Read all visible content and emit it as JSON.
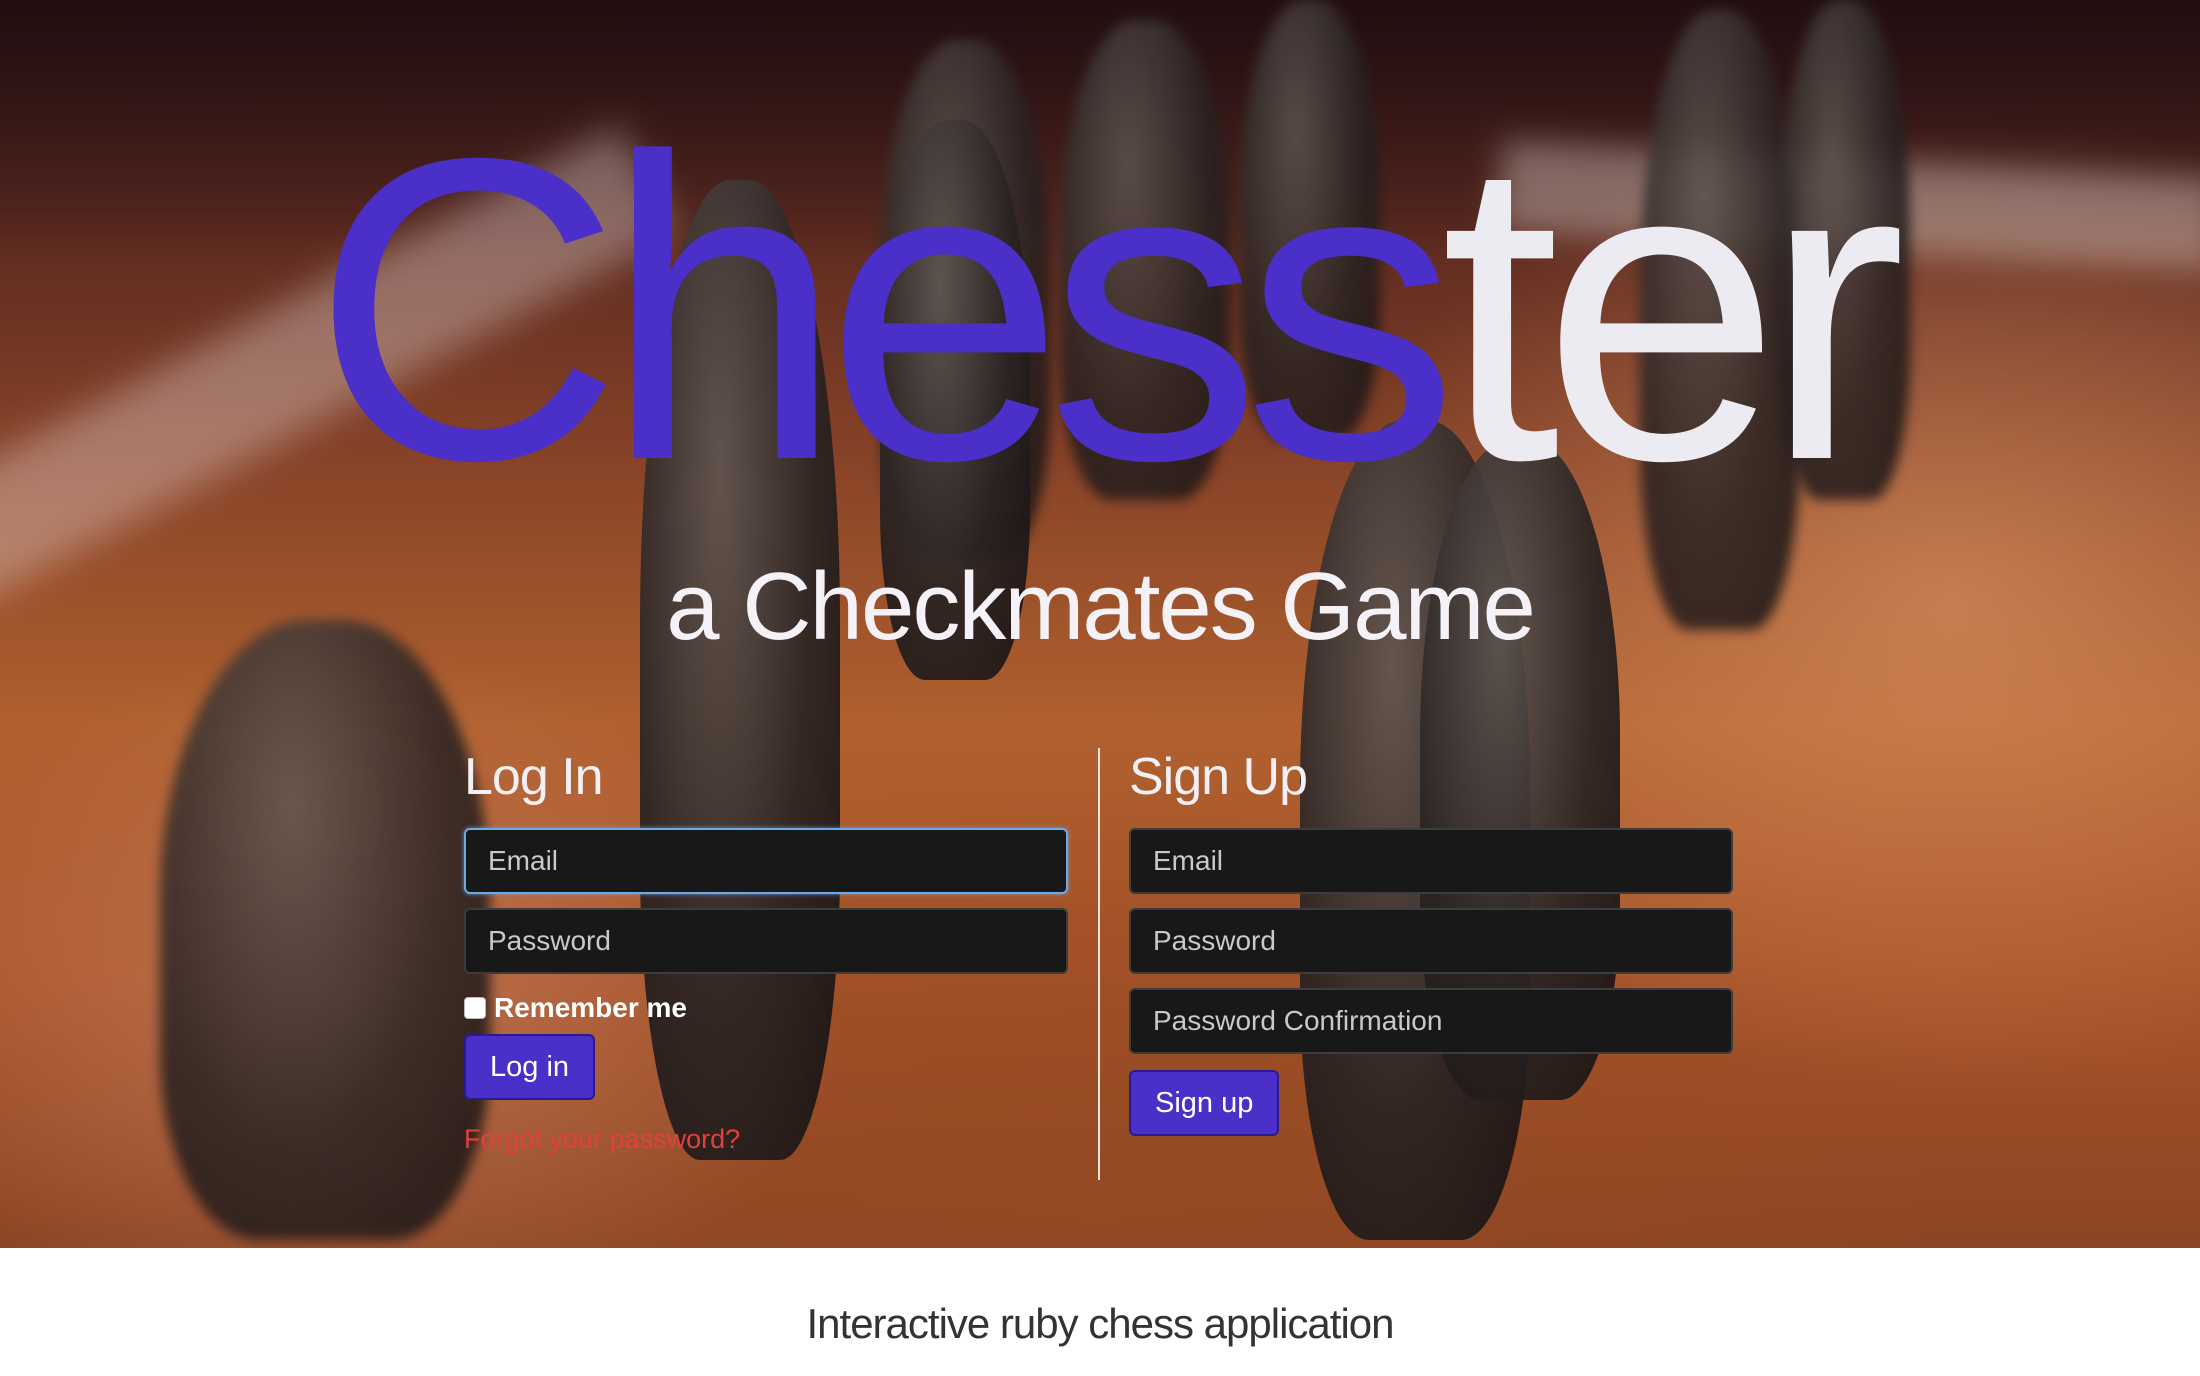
{
  "hero": {
    "title_part_a": "Chess",
    "title_part_b": "ter",
    "subtitle": "a Checkmates Game",
    "colors": {
      "title_accent": "#4a2fc8",
      "title_light": "#ecebf2",
      "button": "#4a2fc8",
      "link": "#e0413f"
    }
  },
  "login": {
    "heading": "Log In",
    "email_placeholder": "Email",
    "password_placeholder": "Password",
    "remember_label": "Remember me",
    "submit_label": "Log in",
    "forgot_label": "Forgot your password?"
  },
  "signup": {
    "heading": "Sign Up",
    "email_placeholder": "Email",
    "password_placeholder": "Password",
    "password_confirmation_placeholder": "Password Confirmation",
    "submit_label": "Sign up"
  },
  "footer": {
    "text": "Interactive ruby chess application"
  }
}
